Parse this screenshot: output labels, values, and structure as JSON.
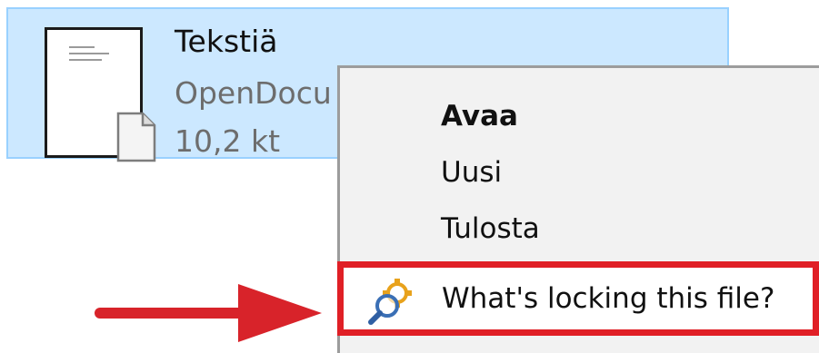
{
  "file": {
    "name": "Tekstiä",
    "type": "OpenDocu",
    "size": "10,2 kt",
    "thumbnail_icon": "document-thumbnail-icon",
    "badge_icon": "libreoffice-document-icon"
  },
  "context_menu": {
    "items": [
      {
        "label": "Avaa",
        "default": true
      },
      {
        "label": "Uusi"
      },
      {
        "label": "Tulosta"
      },
      {
        "label": "What's locking this file?",
        "icon": "lock-search-gear-icon",
        "highlighted": true
      }
    ]
  },
  "colors": {
    "selection_fill": "#cce8ff",
    "selection_border": "#99d1ff",
    "menu_background": "#f2f2f2",
    "highlight_red": "#e01f26",
    "arrow_red": "#d8232a"
  }
}
